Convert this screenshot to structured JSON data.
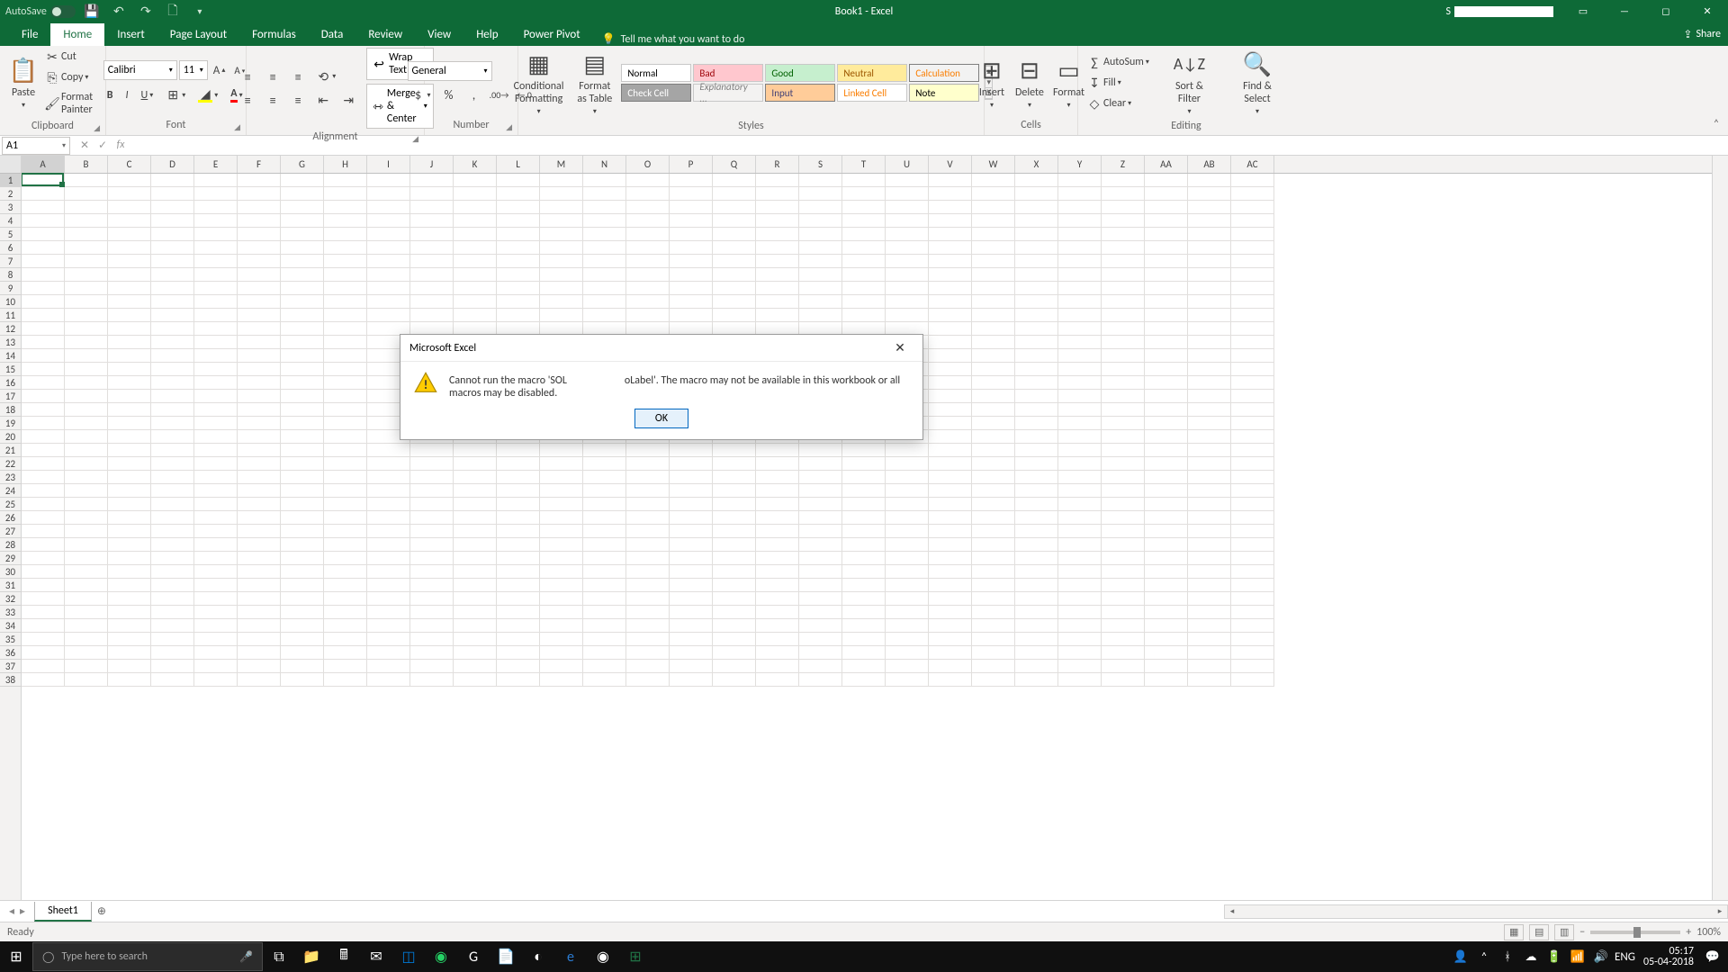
{
  "title_bar": {
    "autosave": "AutoSave",
    "doc": "Book1  -  Excel",
    "account_prefix": "S"
  },
  "tabs": {
    "file": "File",
    "home": "Home",
    "insert": "Insert",
    "page_layout": "Page Layout",
    "formulas": "Formulas",
    "data": "Data",
    "review": "Review",
    "view": "View",
    "help": "Help",
    "power_pivot": "Power Pivot",
    "tell_me": "Tell me what you want to do",
    "share": "Share"
  },
  "ribbon": {
    "clipboard": {
      "label": "Clipboard",
      "paste": "Paste",
      "cut": "Cut",
      "copy": "Copy",
      "painter": "Format Painter"
    },
    "font": {
      "label": "Font",
      "name": "Calibri",
      "size": "11"
    },
    "alignment": {
      "label": "Alignment",
      "wrap": "Wrap Text",
      "merge": "Merge & Center"
    },
    "number": {
      "label": "Number",
      "format": "General"
    },
    "styles": {
      "label": "Styles",
      "cond": "Conditional Formatting",
      "ftable": "Format as Table",
      "row1": [
        "Normal",
        "Bad",
        "Good",
        "Neutral",
        "Calculation"
      ],
      "row2": [
        "Check Cell",
        "Explanatory ...",
        "Input",
        "Linked Cell",
        "Note"
      ]
    },
    "cells": {
      "label": "Cells",
      "insert": "Insert",
      "delete": "Delete",
      "format": "Format"
    },
    "editing": {
      "label": "Editing",
      "autosum": "AutoSum",
      "fill": "Fill",
      "clear": "Clear",
      "sort": "Sort & Filter",
      "find": "Find & Select"
    }
  },
  "formula_bar": {
    "name": "A1",
    "fx": "fx"
  },
  "columns": [
    "A",
    "B",
    "C",
    "D",
    "E",
    "F",
    "G",
    "H",
    "I",
    "J",
    "K",
    "L",
    "M",
    "N",
    "O",
    "P",
    "Q",
    "R",
    "S",
    "T",
    "U",
    "V",
    "W",
    "X",
    "Y",
    "Z",
    "AA",
    "AB",
    "AC"
  ],
  "sheet": {
    "name": "Sheet1"
  },
  "status": {
    "ready": "Ready",
    "zoom": "100%"
  },
  "dialog": {
    "title": "Microsoft Excel",
    "msg_prefix": "Cannot run the macro 'SOL",
    "msg_mid": "oLabel'. The macro may not be available in this workbook or all macros may be disabled.",
    "ok": "OK"
  },
  "taskbar": {
    "search": "Type here to search",
    "lang": "ENG",
    "time": "05:17",
    "date": "05-04-2018"
  }
}
